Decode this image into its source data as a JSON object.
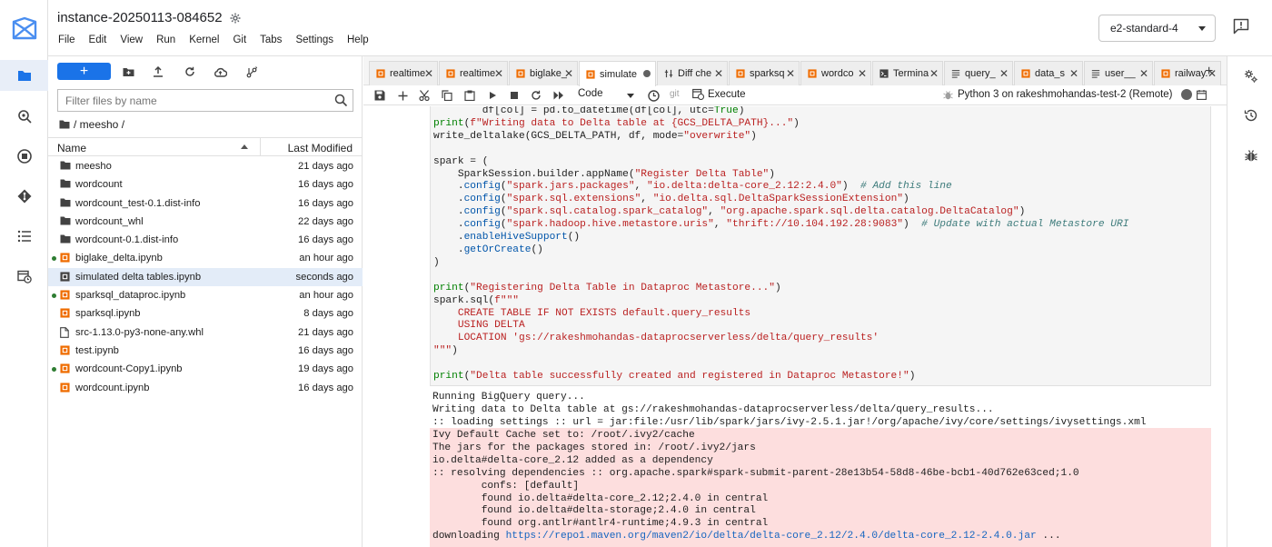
{
  "app": {
    "instance_name": "instance-20250113-084652",
    "machine_type": "e2-standard-4",
    "menu": [
      "File",
      "Edit",
      "View",
      "Run",
      "Kernel",
      "Git",
      "Tabs",
      "Settings",
      "Help"
    ]
  },
  "file_browser": {
    "filter_placeholder": "Filter files by name",
    "breadcrumb": "/ meesho /",
    "col_name": "Name",
    "col_modified": "Last Modified",
    "files": [
      {
        "name": "meesho",
        "modified": "21 days ago",
        "type": "folder",
        "running": false,
        "selected": false
      },
      {
        "name": "wordcount",
        "modified": "16 days ago",
        "type": "folder",
        "running": false,
        "selected": false
      },
      {
        "name": "wordcount_test-0.1.dist-info",
        "modified": "16 days ago",
        "type": "folder",
        "running": false,
        "selected": false
      },
      {
        "name": "wordcount_whl",
        "modified": "22 days ago",
        "type": "folder",
        "running": false,
        "selected": false
      },
      {
        "name": "wordcount-0.1.dist-info",
        "modified": "16 days ago",
        "type": "folder",
        "running": false,
        "selected": false
      },
      {
        "name": "biglake_delta.ipynb",
        "modified": "an hour ago",
        "type": "notebook",
        "running": true,
        "selected": false
      },
      {
        "name": "simulated delta tables.ipynb",
        "modified": "seconds ago",
        "type": "notebook-dark",
        "running": false,
        "selected": true
      },
      {
        "name": "sparksql_dataproc.ipynb",
        "modified": "an hour ago",
        "type": "notebook",
        "running": true,
        "selected": false
      },
      {
        "name": "sparksql.ipynb",
        "modified": "8 days ago",
        "type": "notebook",
        "running": false,
        "selected": false
      },
      {
        "name": "src-1.13.0-py3-none-any.whl",
        "modified": "21 days ago",
        "type": "file",
        "running": false,
        "selected": false
      },
      {
        "name": "test.ipynb",
        "modified": "16 days ago",
        "type": "notebook",
        "running": false,
        "selected": false
      },
      {
        "name": "wordcount-Copy1.ipynb",
        "modified": "19 days ago",
        "type": "notebook",
        "running": true,
        "selected": false
      },
      {
        "name": "wordcount.ipynb",
        "modified": "16 days ago",
        "type": "notebook",
        "running": false,
        "selected": false
      }
    ]
  },
  "tabs": [
    {
      "label": "realtime",
      "icon": "notebook",
      "active": false
    },
    {
      "label": "realtime",
      "icon": "notebook",
      "active": false
    },
    {
      "label": "biglake_",
      "icon": "notebook",
      "active": false
    },
    {
      "label": "simulate",
      "icon": "notebook",
      "active": true
    },
    {
      "label": "Diff che",
      "icon": "diff",
      "active": false
    },
    {
      "label": "sparksq",
      "icon": "notebook",
      "active": false
    },
    {
      "label": "wordco",
      "icon": "notebook",
      "active": false
    },
    {
      "label": "Termina",
      "icon": "terminal",
      "active": false
    },
    {
      "label": "query_",
      "icon": "text",
      "active": false
    },
    {
      "label": "data_s",
      "icon": "notebook",
      "active": false
    },
    {
      "label": "user__",
      "icon": "text",
      "active": false
    },
    {
      "label": "railway.",
      "icon": "notebook",
      "active": false
    }
  ],
  "toolbar": {
    "cell_type": "Code",
    "git_label": "git",
    "execute_label": "Execute",
    "kernel_name": "Python 3 on rakeshmohandas-test-2 (Remote)"
  },
  "output": {
    "stdout": [
      "Running BigQuery query...",
      "Writing data to Delta table at gs://rakeshmohandas-dataprocserverless/delta/query_results...",
      ":: loading settings :: url = jar:file:/usr/lib/spark/jars/ivy-2.5.1.jar!/org/apache/ivy/core/settings/ivysettings.xml"
    ],
    "stderr": [
      "Ivy Default Cache set to: /root/.ivy2/cache",
      "The jars for the packages stored in: /root/.ivy2/jars",
      "io.delta#delta-core_2.12 added as a dependency",
      ":: resolving dependencies :: org.apache.spark#spark-submit-parent-28e13b54-58d8-46be-bcb1-40d762e63ced;1.0",
      "        confs: [default]",
      "        found io.delta#delta-core_2.12;2.4.0 in central",
      "        found io.delta#delta-storage;2.4.0 in central",
      "        found org.antlr#antlr4-runtime;4.9.3 in central"
    ],
    "download_prefix": "downloading ",
    "download_url": "https://repo1.maven.org/maven2/io/delta/delta-core_2.12/2.4.0/delta-core_2.12-2.4.0.jar",
    "download_suffix": " ..."
  }
}
